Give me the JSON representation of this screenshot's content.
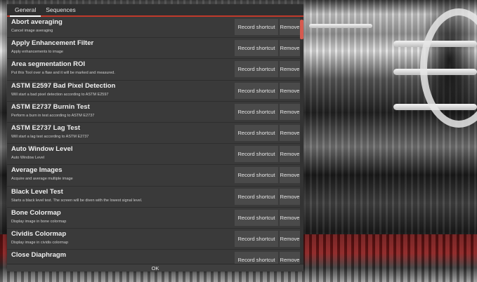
{
  "tabs": [
    {
      "label": "General",
      "active": true
    },
    {
      "label": "Sequences",
      "active": false
    }
  ],
  "button_labels": {
    "record": "Record shortcut",
    "remove": "Remove"
  },
  "rows": [
    {
      "title": "Abort averaging",
      "desc": "Cancel image averaging"
    },
    {
      "title": "Apply Enhancement Filter",
      "desc": "Apply enhancements to image"
    },
    {
      "title": "Area segmentation ROI",
      "desc": "Put this Tool over a flaw and it will be marked and measured."
    },
    {
      "title": "ASTM E2597 Bad Pixel Detection",
      "desc": "Will start a bad pixel detection according to ASTM E2597"
    },
    {
      "title": "ASTM E2737 Burnin Test",
      "desc": "Perform a burn in test according to ASTM E2737"
    },
    {
      "title": "ASTM E2737 Lag Test",
      "desc": "Will start a lag test according to ASTM E2737"
    },
    {
      "title": "Auto Window Level",
      "desc": "Auto Window Level"
    },
    {
      "title": "Average Images",
      "desc": "Acquire and average multiple image"
    },
    {
      "title": "Black Level Test",
      "desc": "Starts a black level test. The screen will be diven with the lowest signal level."
    },
    {
      "title": "Bone Colormap",
      "desc": "Display image in bone colormap"
    },
    {
      "title": "Cividis Colormap",
      "desc": "Display image in cividis colormap"
    },
    {
      "title": "Close Diaphragm",
      "desc": ""
    }
  ],
  "ok_label": "OK",
  "colors": {
    "accent": "#c0392b",
    "scroll_thumb": "#d65a4f",
    "dialog_bg": "#3a3a3a",
    "button_bg": "#4a4a4a"
  }
}
